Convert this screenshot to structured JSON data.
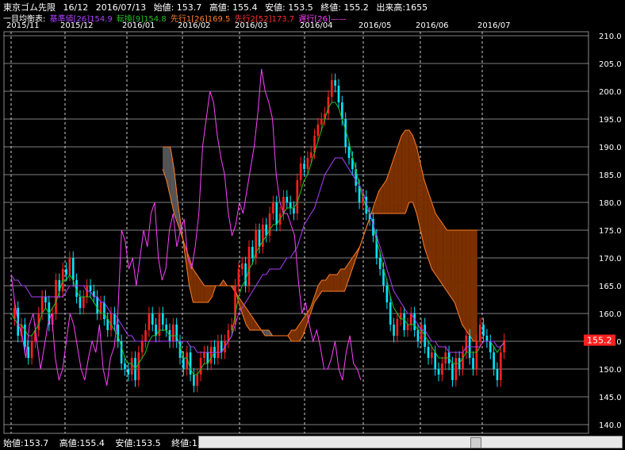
{
  "header": {
    "instrument": "東京ゴム先限",
    "contract": "16/12",
    "date": "2016/07/13",
    "open": "始値: 153.7",
    "high": "高値: 155.4",
    "low": "安値: 153.5",
    "close": "終値: 155.2",
    "volume": "出来高:1655"
  },
  "legend": {
    "prefix": "一目均衡表:",
    "kijun": "基準値[26]154.9",
    "tenkan": "転換[9]154.8",
    "senkou1": "先行1[26]169.5",
    "senkou2": "先行2[52]173.7",
    "chikou": "遅行[26]——",
    "colors": {
      "kijun": "#b040ff",
      "tenkan": "#20c020",
      "senkou1": "#ff7f27",
      "senkou2": "#ff3030",
      "chikou": "#ff40ff"
    }
  },
  "footer": {
    "open": "始値:153.7",
    "high": "高値:155.4",
    "low": "安値:153.5",
    "close": "終値:155.2"
  },
  "chart_data": {
    "type": "candlestick",
    "ylim": [
      140,
      210
    ],
    "yticks": [
      "210.0",
      "205.0",
      "200.0",
      "195.0",
      "190.0",
      "185.0",
      "180.0",
      "175.0",
      "170.0",
      "165.0",
      "160.0",
      "155.0",
      "150.0",
      "145.0",
      "140.0"
    ],
    "months": [
      "2015/11",
      "2015/12",
      "2016/01",
      "2016/02",
      "2016/03",
      "2016/04",
      "2016/05",
      "2016/06",
      "2016/07"
    ],
    "last_price": "155.2",
    "colors": {
      "up": "#ff2020",
      "down": "#00e5ff",
      "cloud_bull": "#7a3000",
      "cloud_bear": "#555555",
      "cloud_edge": "#ff7f27",
      "kijun": "#b040ff",
      "tenkan": "#20c020",
      "chikou": "#ff40ff",
      "grid": "#ffffff",
      "price_tag": "#ff2020"
    },
    "candles_close": [
      159,
      161,
      156,
      158,
      154,
      152,
      155,
      157,
      160,
      163,
      162,
      158,
      160,
      166,
      164,
      168,
      167,
      170,
      166,
      163,
      161,
      163,
      165,
      164,
      163,
      160,
      162,
      159,
      157,
      160,
      158,
      155,
      151,
      150,
      149,
      152,
      148,
      153,
      155,
      157,
      160,
      158,
      156,
      160,
      158,
      157,
      155,
      158,
      155,
      152,
      150,
      153,
      149,
      147,
      149,
      152,
      153,
      151,
      154,
      152,
      155,
      153,
      155,
      157,
      158,
      165,
      168,
      169,
      165,
      172,
      170,
      175,
      172,
      176,
      174,
      178,
      180,
      176,
      178,
      181,
      180,
      179,
      178,
      184,
      187,
      186,
      188,
      189,
      192,
      194,
      195,
      196,
      199,
      202,
      201,
      198,
      195,
      190,
      188,
      186,
      183,
      180,
      181,
      178,
      177,
      174,
      170,
      168,
      165,
      162,
      158,
      156,
      159,
      160,
      157,
      158,
      160,
      157,
      155,
      158,
      154,
      152,
      153,
      150,
      149,
      151,
      153,
      151,
      148,
      152,
      150,
      153,
      156,
      152,
      150,
      155,
      158,
      156,
      155,
      153,
      150,
      148,
      153,
      155.2
    ],
    "tenkan": [
      160,
      159,
      158,
      158,
      157,
      156,
      156,
      157,
      158,
      160,
      161,
      160,
      161,
      162,
      164,
      166,
      166,
      167,
      166,
      164,
      163,
      163,
      163,
      163,
      162,
      161,
      160,
      160,
      159,
      158,
      157,
      156,
      154,
      152,
      151,
      151,
      150,
      151,
      152,
      153,
      155,
      156,
      156,
      157,
      157,
      157,
      156,
      156,
      156,
      154,
      152,
      152,
      150,
      149,
      149,
      150,
      151,
      151,
      152,
      153,
      153,
      153,
      154,
      155,
      156,
      160,
      163,
      165,
      166,
      168,
      169,
      171,
      172,
      173,
      174,
      175,
      176,
      176,
      177,
      178,
      179,
      179,
      179,
      180,
      182,
      184,
      185,
      187,
      189,
      191,
      193,
      195,
      197,
      198,
      198,
      197,
      195,
      193,
      191,
      188,
      186,
      183,
      181,
      179,
      178,
      176,
      173,
      171,
      168,
      166,
      163,
      161,
      160,
      159,
      159,
      158,
      158,
      158,
      157,
      157,
      156,
      155,
      154,
      153,
      152,
      152,
      152,
      152,
      151,
      151,
      151,
      152,
      153,
      153,
      153,
      153,
      154,
      155,
      155,
      155,
      154,
      153,
      154,
      154.8
    ],
    "kijun": [
      167,
      166,
      166,
      165,
      165,
      164,
      163,
      163,
      163,
      163,
      163,
      163,
      163,
      163,
      163,
      163,
      164,
      165,
      165,
      165,
      165,
      165,
      164,
      164,
      163,
      163,
      162,
      162,
      161,
      160,
      160,
      159,
      158,
      157,
      156,
      156,
      155,
      155,
      155,
      155,
      155,
      155,
      155,
      155,
      155,
      155,
      155,
      155,
      155,
      155,
      155,
      155,
      154,
      154,
      153,
      153,
      153,
      153,
      153,
      153,
      153,
      153,
      154,
      155,
      156,
      158,
      160,
      161,
      162,
      163,
      164,
      165,
      166,
      167,
      167,
      168,
      168,
      168,
      168,
      169,
      170,
      170,
      171,
      172,
      174,
      176,
      177,
      178,
      179,
      181,
      183,
      185,
      186,
      187,
      188,
      188,
      188,
      187,
      186,
      185,
      184,
      183,
      182,
      180,
      178,
      176,
      174,
      172,
      170,
      168,
      166,
      164,
      163,
      162,
      161,
      160,
      160,
      159,
      158,
      157,
      157,
      156,
      155,
      155,
      154,
      154,
      154,
      153,
      153,
      153,
      153,
      153,
      154,
      154,
      154,
      154,
      154,
      155,
      155,
      155,
      155,
      154,
      154,
      154.9
    ],
    "chikou": [
      167,
      162,
      158,
      156,
      152,
      158,
      160,
      155,
      150,
      154,
      158,
      160,
      152,
      148,
      150,
      155,
      160,
      158,
      154,
      150,
      148,
      152,
      155,
      153,
      158,
      150,
      147,
      152,
      154,
      160,
      175,
      173,
      168,
      170,
      165,
      170,
      175,
      172,
      178,
      180,
      170,
      166,
      168,
      175,
      178,
      172,
      175,
      177,
      170,
      168,
      172,
      178,
      190,
      195,
      200,
      198,
      192,
      188,
      185,
      178,
      174,
      176,
      180,
      178,
      182,
      186,
      190,
      196,
      204,
      200,
      198,
      195,
      185,
      180,
      178,
      178,
      176,
      174,
      166,
      160,
      162,
      158,
      155,
      157,
      154,
      150,
      150,
      152,
      155,
      150,
      148,
      153,
      156,
      151,
      150,
      148
    ],
    "senkou_a": [
      null,
      null,
      null,
      null,
      null,
      null,
      null,
      null,
      null,
      null,
      null,
      null,
      null,
      null,
      null,
      null,
      null,
      null,
      null,
      null,
      null,
      null,
      null,
      null,
      null,
      null,
      null,
      null,
      null,
      null,
      null,
      null,
      null,
      null,
      null,
      null,
      null,
      null,
      null,
      null,
      null,
      null,
      null,
      null,
      null,
      null,
      null,
      null,
      null,
      null,
      null,
      null,
      186,
      184,
      181,
      178,
      176,
      174,
      172,
      170,
      168,
      167,
      166,
      165,
      165,
      165,
      165,
      165,
      166,
      165,
      165,
      164,
      163,
      162,
      161,
      160,
      159,
      158,
      157,
      156,
      156,
      156,
      156,
      156,
      156,
      156,
      157,
      157,
      158,
      159,
      160,
      161,
      163,
      165,
      166,
      166,
      167,
      167,
      167,
      168,
      168,
      169,
      170,
      171,
      172,
      174,
      176,
      178,
      180,
      182,
      183,
      184,
      186,
      188,
      190,
      192,
      193,
      193,
      192,
      190,
      187,
      184,
      182,
      180,
      178,
      177,
      176,
      175,
      175,
      175,
      175,
      175,
      175,
      175,
      175,
      175
    ],
    "senkou_b": [
      null,
      null,
      null,
      null,
      null,
      null,
      null,
      null,
      null,
      null,
      null,
      null,
      null,
      null,
      null,
      null,
      null,
      null,
      null,
      null,
      null,
      null,
      null,
      null,
      null,
      null,
      null,
      null,
      null,
      null,
      null,
      null,
      null,
      null,
      null,
      null,
      null,
      null,
      null,
      null,
      null,
      null,
      null,
      null,
      null,
      null,
      null,
      null,
      null,
      null,
      null,
      null,
      190,
      190,
      190,
      186,
      180,
      175,
      170,
      165,
      162,
      162,
      162,
      162,
      162,
      163,
      165,
      165,
      165,
      165,
      165,
      165,
      162,
      160,
      158,
      157,
      157,
      157,
      157,
      157,
      157,
      156,
      156,
      156,
      156,
      156,
      155,
      155,
      155,
      156,
      158,
      160,
      162,
      163,
      164,
      164,
      164,
      164,
      164,
      164,
      164,
      166,
      168,
      170,
      172,
      174,
      176,
      178,
      178,
      178,
      178,
      178,
      178,
      178,
      178,
      178,
      178,
      180,
      180,
      178,
      175,
      172,
      170,
      168,
      167,
      166,
      165,
      164,
      163,
      162,
      160,
      158,
      157,
      156,
      155,
      155
    ]
  }
}
